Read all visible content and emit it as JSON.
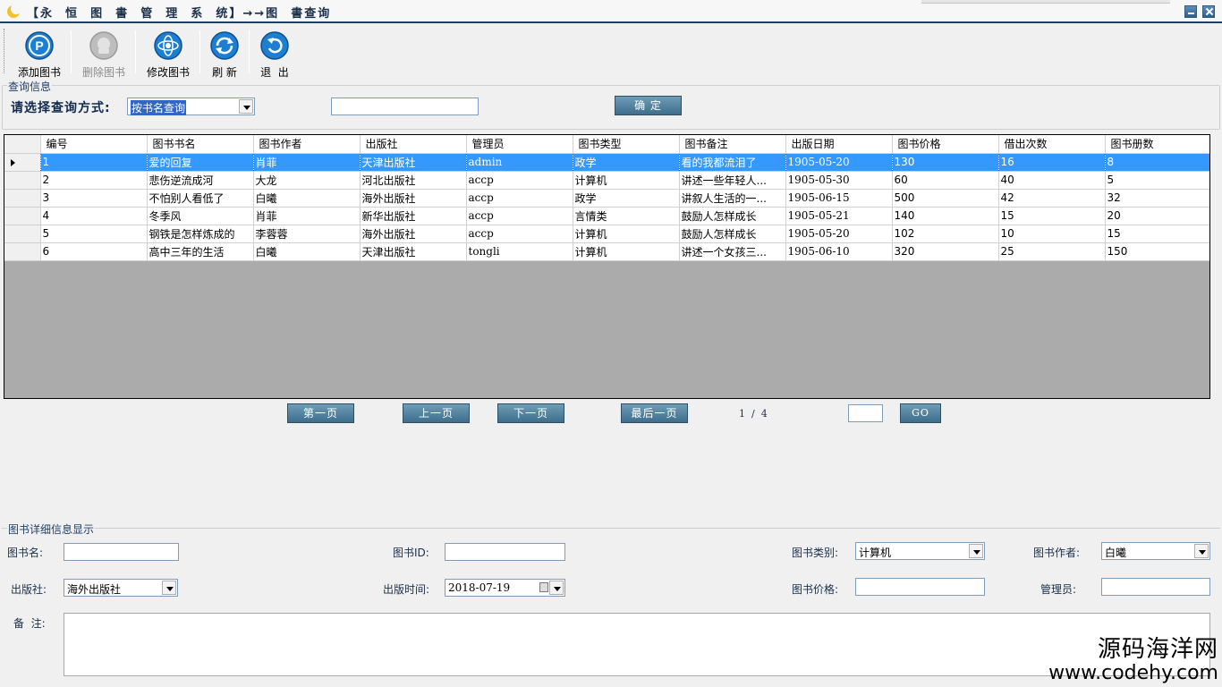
{
  "window": {
    "title": "【永  恒  图  書  管  理  系  统】→→图  書查询"
  },
  "toolbar": {
    "add": "添加图书",
    "delete": "删除图书",
    "edit": "修改图书",
    "refresh": "刷 新",
    "exit": "退  出"
  },
  "query": {
    "legend": "查询信息",
    "prompt": "请选择查询方式:",
    "method": "按书名查询",
    "confirm": "确 定"
  },
  "grid": {
    "columns": [
      "编号",
      "图书书名",
      "图书作者",
      "出版社",
      "管理员",
      "图书类型",
      "图书备注",
      "出版日期",
      "图书价格",
      "借出次数",
      "图书册数"
    ],
    "rows": [
      [
        "1",
        "爱的回复",
        "肖菲",
        "天津出版社",
        "admin",
        "政学",
        "看的我都流泪了",
        "1905-05-20",
        "130",
        "16",
        "8"
      ],
      [
        "2",
        "悲伤逆流成河",
        "大龙",
        "河北出版社",
        "accp",
        "计算机",
        "讲述一些年轻人...",
        "1905-05-30",
        "60",
        "40",
        "5"
      ],
      [
        "3",
        "不怕别人看低了",
        "白曦",
        "海外出版社",
        "accp",
        "政学",
        "讲叙人生活的一...",
        "1905-06-15",
        "500",
        "42",
        "32"
      ],
      [
        "4",
        "冬季风",
        "肖菲",
        "新华出版社",
        "accp",
        "言情类",
        "鼓励人怎样成长",
        "1905-05-21",
        "140",
        "15",
        "20"
      ],
      [
        "5",
        "钢铁是怎样炼成的",
        "李蓉蓉",
        "海外出版社",
        "accp",
        "计算机",
        "鼓励人怎样成长",
        "1905-05-20",
        "102",
        "10",
        "15"
      ],
      [
        "6",
        "高中三年的生活",
        "白曦",
        "天津出版社",
        "tongli",
        "计算机",
        "讲述一个女孩三...",
        "1905-06-10",
        "320",
        "25",
        "150"
      ]
    ],
    "selected_row": 0
  },
  "pager": {
    "first": "第一页",
    "prev": "上一页",
    "next": "下一页",
    "last": "最后一页",
    "status": "1  /  4",
    "go": "GO"
  },
  "detail": {
    "legend": "图书详细信息显示",
    "name_label": "图书名:",
    "id_label": "图书ID:",
    "category_label": "图书类别:",
    "category_value": "计算机",
    "author_label": "图书作者:",
    "author_value": "白曦",
    "publisher_label": "出版社:",
    "publisher_value": "海外出版社",
    "pubtime_label": "出版时间:",
    "pubtime_value": "2018-07-19",
    "price_label": "图书价格:",
    "admin_label": "管理员:",
    "remark_label": "备  注:"
  },
  "watermark": {
    "line1": "源码海洋网",
    "line2": "www.codehy.com"
  },
  "colors": {
    "selection": "#3399ff",
    "button": "#4f7f9c",
    "title_text": "#1a2f4a"
  }
}
